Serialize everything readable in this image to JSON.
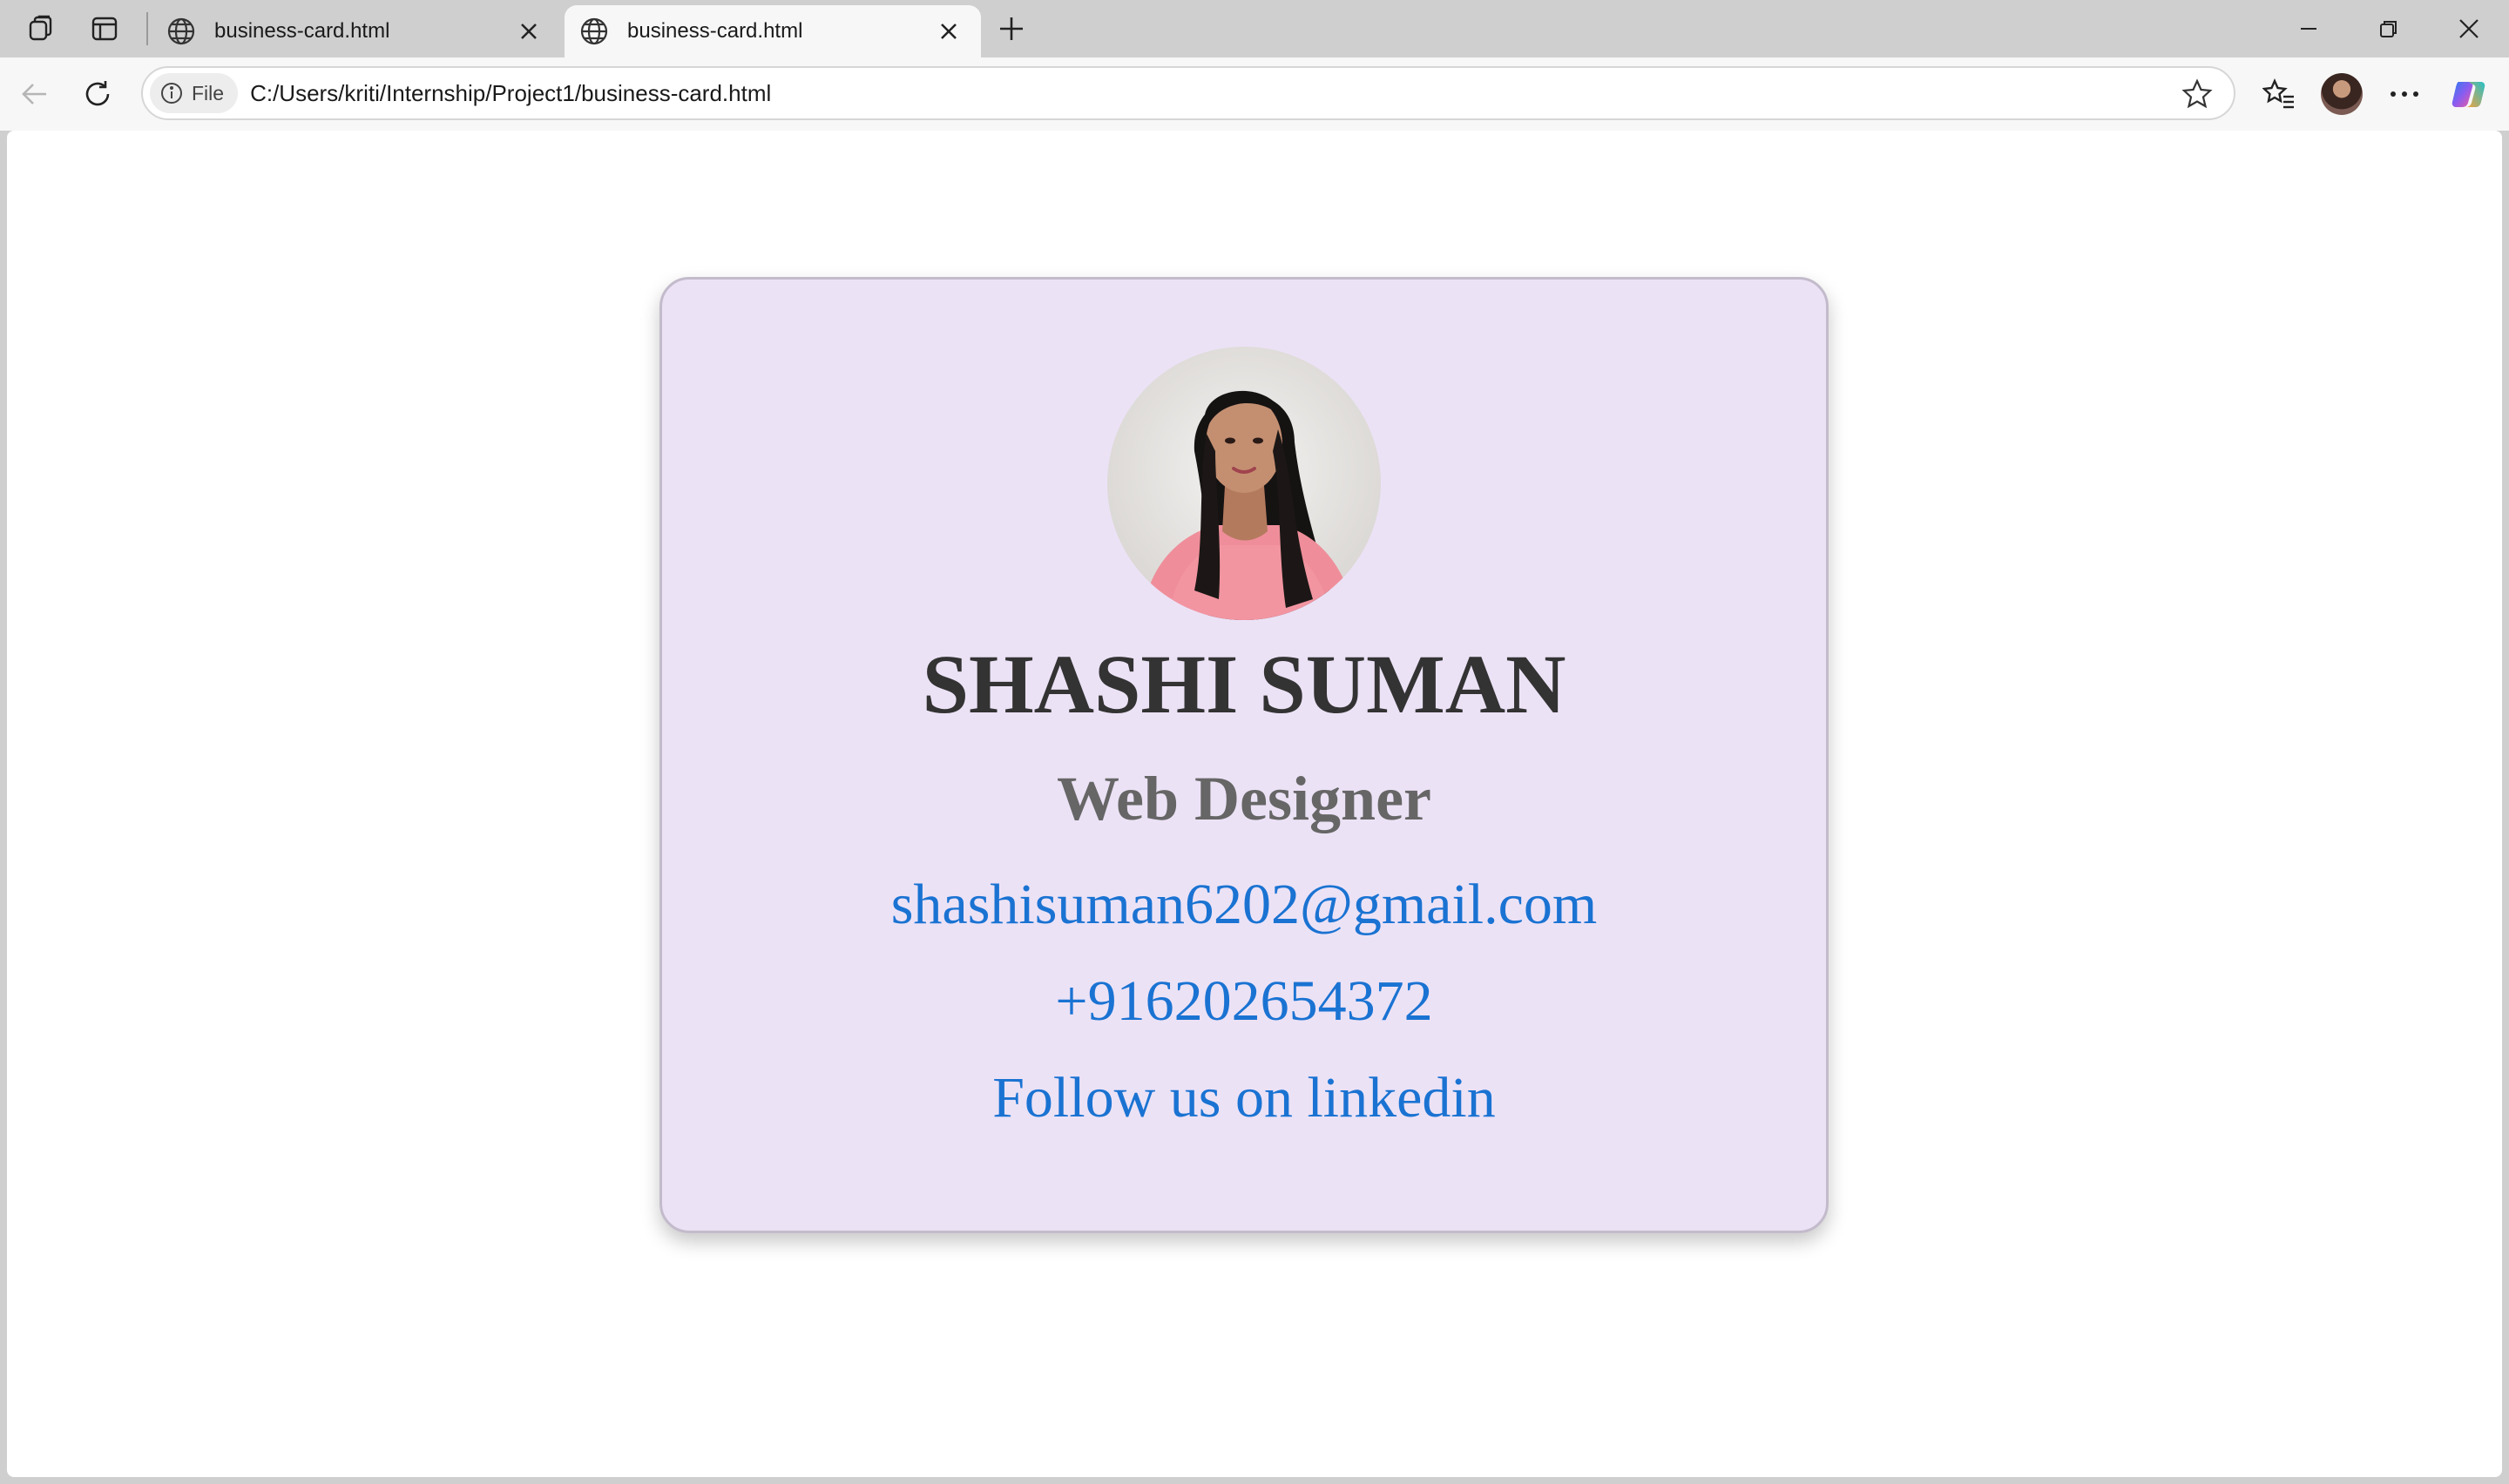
{
  "browser": {
    "tabs": [
      {
        "title": "business-card.html",
        "active": false
      },
      {
        "title": "business-card.html",
        "active": true
      }
    ],
    "address": {
      "scheme_label": "File",
      "url": "C:/Users/kriti/Internship/Project1/business-card.html"
    },
    "icons": {
      "workspaces": "workspaces-icon",
      "tab_actions": "vertical-tabs-icon",
      "tab_favicon": "globe-icon",
      "close_tab": "close-icon",
      "new_tab": "plus-icon",
      "back": "back-arrow-icon",
      "refresh": "refresh-icon",
      "site_info": "info-icon",
      "favorite": "star-icon",
      "favorites": "favorites-icon",
      "profile": "profile-avatar",
      "more": "more-icon",
      "copilot": "copilot-icon",
      "minimize": "minimize-icon",
      "restore": "restore-icon",
      "close_window": "close-icon"
    }
  },
  "card": {
    "name": "SHASHI SUMAN",
    "role": "Web Designer",
    "email": "shashisuman6202@gmail.com",
    "phone": "+916202654372",
    "linkedin_label": "Follow us on linkedin",
    "colors": {
      "background": "#ece2f6",
      "name": "#333333",
      "role": "#666666",
      "link": "#1a73d2"
    }
  }
}
